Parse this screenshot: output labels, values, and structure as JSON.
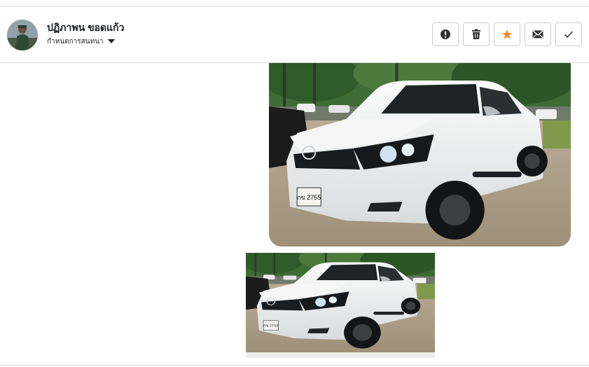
{
  "header": {
    "contact_name": "ปฏิภาพน ขอดแก้ว",
    "subtitle": "กำหนดการสนทนา",
    "avatar_icon": "person-avatar",
    "actions": [
      {
        "icon": "exclamation-circle-icon",
        "color": "#333333"
      },
      {
        "icon": "trash-icon",
        "color": "#333333"
      },
      {
        "icon": "star-icon",
        "color": "#f28a28"
      },
      {
        "icon": "envelope-icon",
        "color": "#333333"
      },
      {
        "icon": "checkmark-icon",
        "color": "#333333"
      }
    ]
  },
  "messages": [
    {
      "type": "image",
      "subject": "white-pickup-truck",
      "plate_text": "กข 2755"
    },
    {
      "type": "image",
      "subject": "white-pickup-truck",
      "plate_text": "กข 2755"
    }
  ]
}
